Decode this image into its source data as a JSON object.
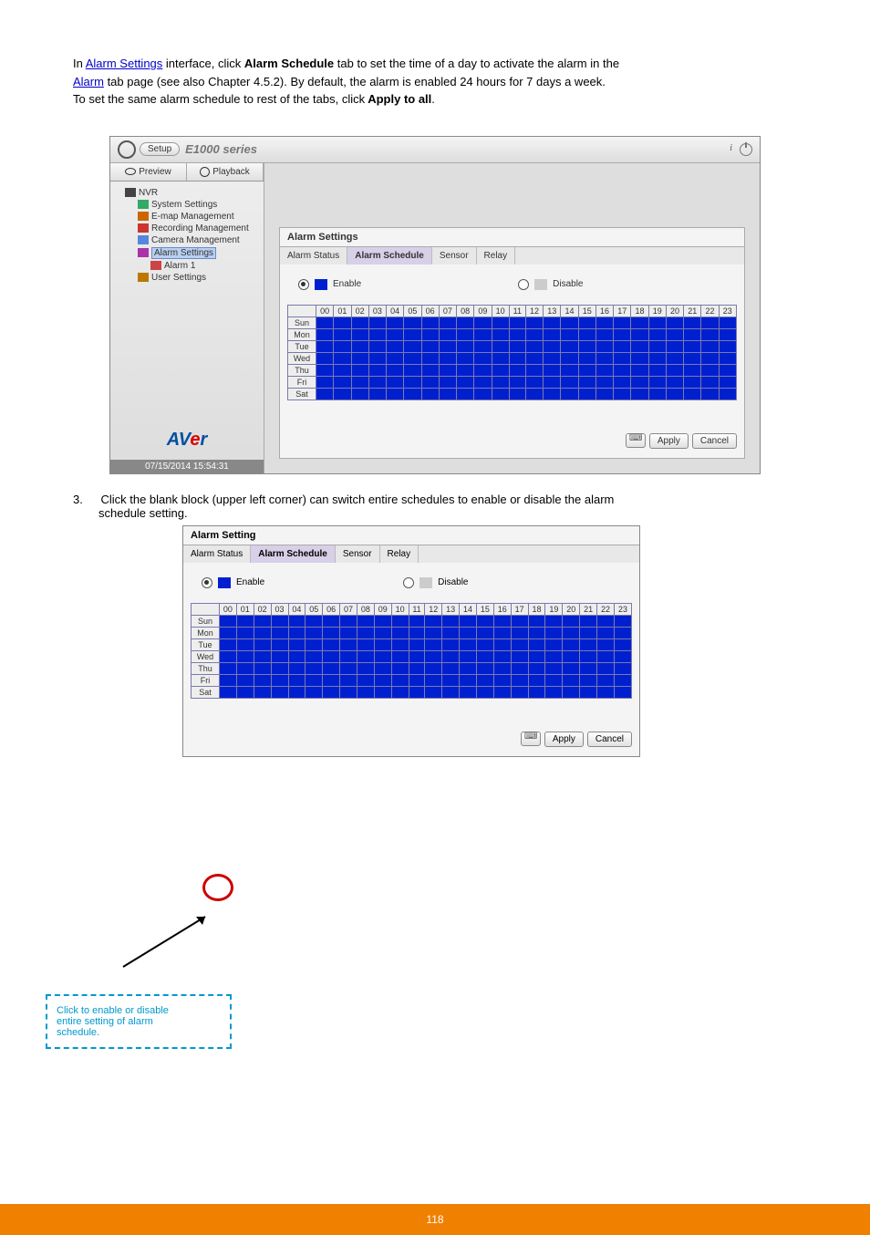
{
  "intro": {
    "line1_pre": "In ",
    "line1_link": "Alarm Settings",
    "line1_post": " interface, click ",
    "line1_bold": "Alarm Schedule",
    "line1_after": " tab to set the time of a day to activate the alarm in the",
    "line2_link": "Alarm",
    "line2_post": " tab page (see also Chapter 4.5.2). By default, the alarm is enabled 24 hours for 7 days a week.",
    "line3": "To set the same alarm schedule to rest of the tabs, click",
    "line3_bold": " Apply to all"
  },
  "screenshot1": {
    "setup": "Setup",
    "series": "E1000 series",
    "preview": "Preview",
    "playback": "Playback",
    "tree": {
      "nvr": "NVR",
      "system_settings": "System Settings",
      "emap": "E-map Management",
      "recording": "Recording Management",
      "camera": "Camera Management",
      "alarm_settings": "Alarm Settings",
      "alarm1": "Alarm 1",
      "user_settings": "User Settings"
    },
    "brand_a": "AV",
    "brand_e": "e",
    "brand_r": "r",
    "timestamp": "07/15/2014 15:54:31",
    "panel_title": "Alarm Settings",
    "tabs": {
      "status": "Alarm Status",
      "schedule": "Alarm Schedule",
      "sensor": "Sensor",
      "relay": "Relay"
    },
    "enable": "Enable",
    "disable": "Disable",
    "hours": [
      "00",
      "01",
      "02",
      "03",
      "04",
      "05",
      "06",
      "07",
      "08",
      "09",
      "10",
      "11",
      "12",
      "13",
      "14",
      "15",
      "16",
      "17",
      "18",
      "19",
      "20",
      "21",
      "22",
      "23"
    ],
    "days": [
      "Sun",
      "Mon",
      "Tue",
      "Wed",
      "Thu",
      "Fri",
      "Sat"
    ],
    "apply": "Apply",
    "cancel": "Cancel"
  },
  "step3": {
    "num": "3.",
    "text_pre": "Click  the  blank  block  (upper  left  corner)  can  switch  entire  schedules  to  enable  or  disable  the  alarm",
    "text_post": "schedule setting."
  },
  "screenshot2": {
    "panel_title": "Alarm Setting"
  },
  "annot": {
    "line1": "Click to enable or disable",
    "line2": "entire setting of alarm",
    "line3": "schedule."
  },
  "footer": "118"
}
